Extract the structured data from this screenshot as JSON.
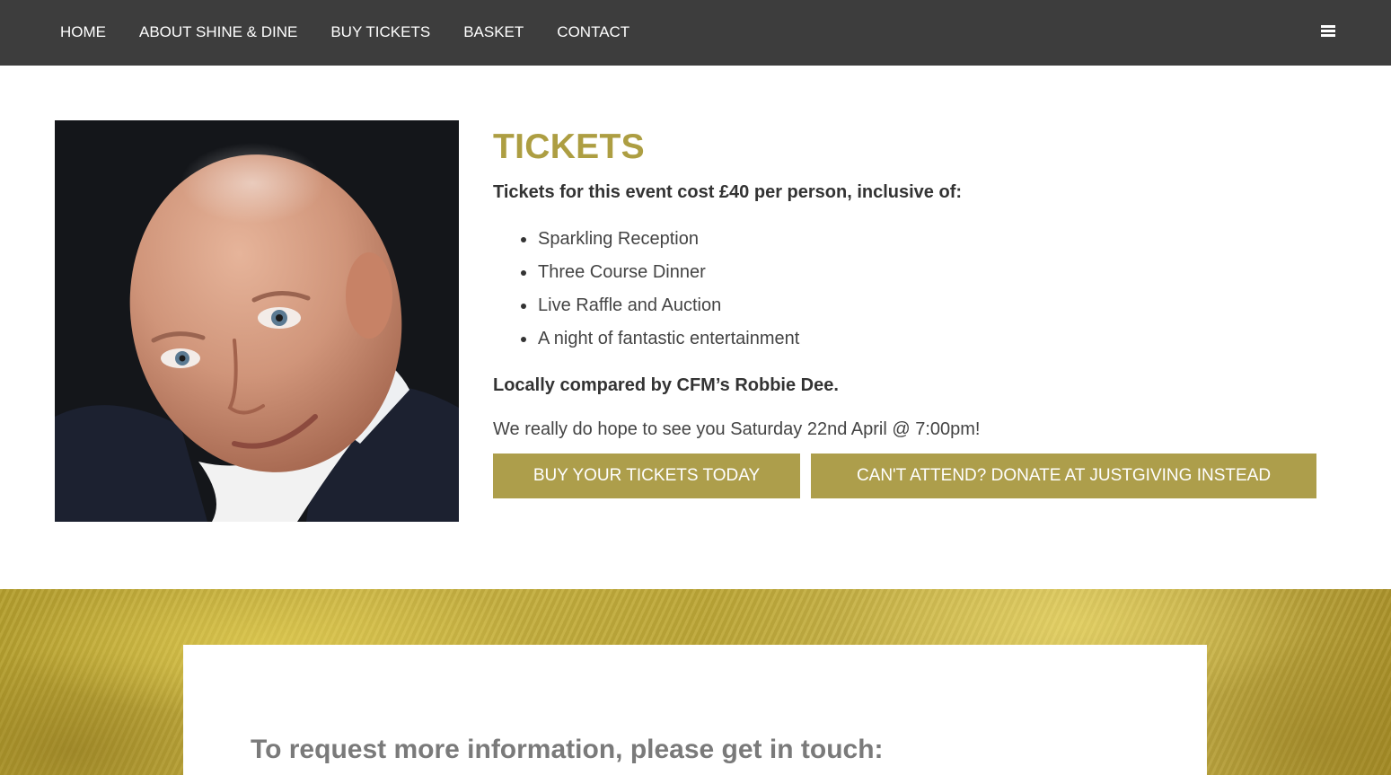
{
  "nav": {
    "items": [
      {
        "label": "HOME"
      },
      {
        "label": "ABOUT SHINE & DINE"
      },
      {
        "label": "BUY TICKETS"
      },
      {
        "label": "BASKET"
      },
      {
        "label": "CONTACT"
      }
    ],
    "menu_icon": "hamburger-menu-icon"
  },
  "tickets": {
    "title": "TICKETS",
    "intro": "Tickets for this event cost £40 per person, inclusive of:",
    "features": [
      "Sparkling Reception",
      "Three Course Dinner",
      "Live Raffle and Auction",
      "A night of fantastic entertainment"
    ],
    "compere": "Locally compared by CFM’s Robbie Dee.",
    "hope": "We really do hope to see you Saturday 22nd April @ 7:00pm!",
    "buy_button": "BUY YOUR TICKETS TODAY",
    "donate_button": "CAN'T ATTEND? DONATE AT JUSTGIVING INSTEAD"
  },
  "contact_card": {
    "heading": "To request more information, please get in touch:"
  },
  "colors": {
    "nav_bg": "#3d3d3d",
    "accent_gold": "#ad9e42",
    "button_gold": "#ad9e4b",
    "heading_grey": "#7a7a7a"
  }
}
